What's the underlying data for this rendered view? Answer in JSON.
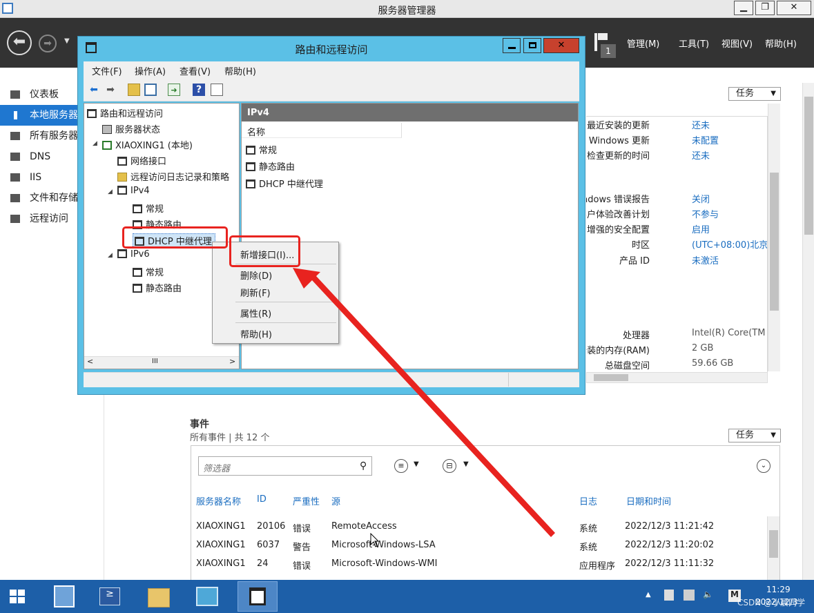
{
  "server_manager": {
    "title": "服务器管理器",
    "window_buttons": [
      "▁",
      "❐",
      "✕"
    ],
    "menus": [
      "管理(M)",
      "工具(T)",
      "视图(V)",
      "帮助(H)"
    ],
    "flag_count": "1",
    "nav": [
      {
        "label": "仪表板",
        "icon": "dashboard-icon"
      },
      {
        "label": "本地服务器",
        "icon": "local-server-icon"
      },
      {
        "label": "所有服务器",
        "icon": "all-servers-icon"
      },
      {
        "label": "DNS",
        "icon": "dns-icon"
      },
      {
        "label": "IIS",
        "icon": "iis-icon"
      },
      {
        "label": "文件和存储服务",
        "icon": "file-storage-icon"
      },
      {
        "label": "远程访问",
        "icon": "remote-access-icon"
      }
    ],
    "tasks_label": "任务",
    "properties": [
      {
        "label": "最近安装的更新",
        "value": "还未"
      },
      {
        "label": "Windows 更新",
        "value": "未配置"
      },
      {
        "label": "上次检查更新的时间",
        "value": "还未"
      },
      {
        "label": "Windows 错误报告",
        "value": "关闭"
      },
      {
        "label": "客户体验改善计划",
        "value": "不参与"
      },
      {
        "label": "IE 增强的安全配置",
        "value": "启用"
      },
      {
        "label": "时区",
        "value": "(UTC+08:00)北京"
      },
      {
        "label": "产品 ID",
        "value": "未激活"
      },
      {
        "label": "处理器",
        "value": "Intel(R) Core(TM"
      },
      {
        "label": "安装的内存(RAM)",
        "value": "2 GB"
      },
      {
        "label": "总磁盘空间",
        "value": "59.66 GB"
      }
    ],
    "events": {
      "title": "事件",
      "subtitle": "所有事件 | 共 12 个",
      "tasks_label": "任务",
      "filter_placeholder": "筛选器",
      "columns": [
        "服务器名称",
        "ID",
        "严重性",
        "源",
        "日志",
        "日期和时间"
      ],
      "rows": [
        [
          "XIAOXING1",
          "20106",
          "错误",
          "RemoteAccess",
          "系统",
          "2022/12/3 11:21:42"
        ],
        [
          "XIAOXING1",
          "6037",
          "警告",
          "Microsoft-Windows-LSA",
          "系统",
          "2022/12/3 11:20:02"
        ],
        [
          "XIAOXING1",
          "24",
          "错误",
          "Microsoft-Windows-WMI",
          "应用程序",
          "2022/12/3 11:11:32"
        ]
      ]
    }
  },
  "rras": {
    "title": "路由和远程访问",
    "menus": [
      "文件(F)",
      "操作(A)",
      "查看(V)",
      "帮助(H)"
    ],
    "tree": {
      "root": "路由和远程访问",
      "status": "服务器状态",
      "server": "XIAOXING1 (本地)",
      "net_if": "网络接口",
      "log": "远程访问日志记录和策略",
      "ipv4": "IPv4",
      "ipv4_general": "常规",
      "ipv4_static": "静态路由",
      "dhcp_relay": "DHCP 中继代理",
      "ipv6": "IPv6",
      "ipv6_general": "常规",
      "ipv6_static": "静态路由"
    },
    "panel_header": "IPv4",
    "column_name": "名称",
    "items": [
      "常规",
      "静态路由",
      "DHCP 中继代理"
    ],
    "scroll_mid": "III"
  },
  "context_menu": {
    "new_interface": "新增接口(I)...",
    "delete": "删除(D)",
    "refresh": "刷新(F)",
    "properties": "属性(R)",
    "help": "帮助(H)"
  },
  "taskbar": {
    "time": "11:29",
    "date": "2022/12/3",
    "watermark": "CSDN @小晨同学"
  },
  "colors": {
    "accent": "#1f77d0",
    "header_dark": "#333333",
    "rras_frame": "#5bc0e6",
    "highlight_red": "#e8231f",
    "taskbar": "#1d5fa8"
  }
}
